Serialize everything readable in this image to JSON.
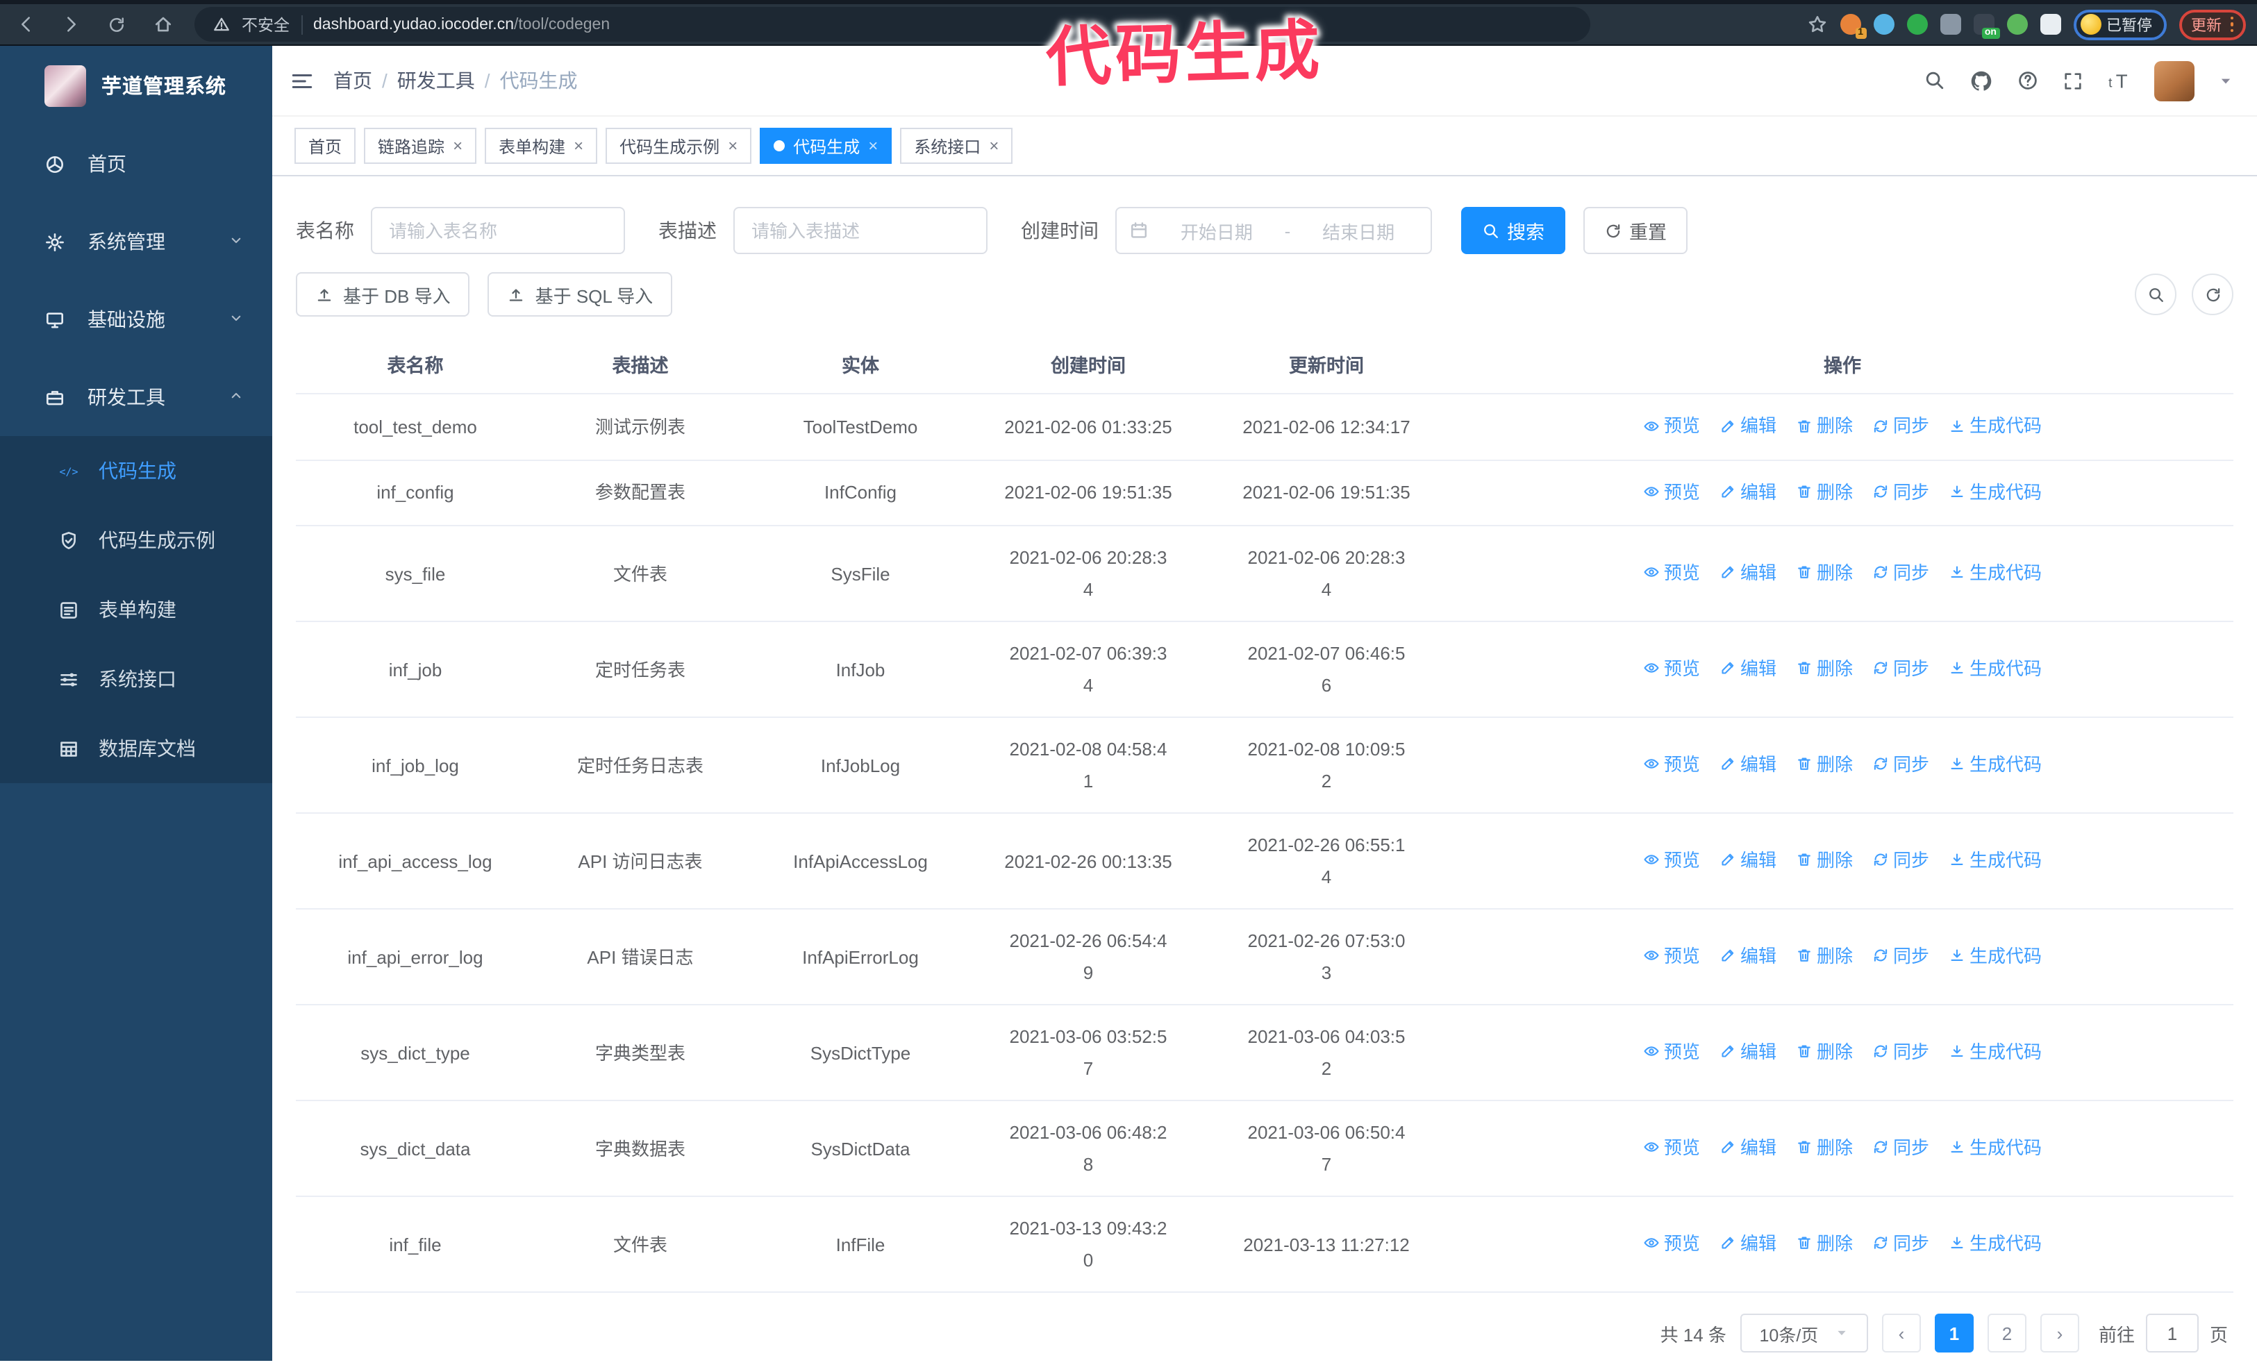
{
  "colors": {
    "accent": "#1890ff",
    "link": "#409eff",
    "sidebar_bg": "#204668",
    "submenu_bg": "#1a3a57",
    "annotation": "#fb3a5e"
  },
  "annotation": {
    "text": "代码生成"
  },
  "browser": {
    "insecure_label": "不安全",
    "url_domain": "dashboard.yudao.iocoder.cn",
    "url_path": "/tool/codegen",
    "paused_label": "已暂停",
    "update_label": "更新",
    "extensions": [
      {
        "name": "extension-orange-icon",
        "color": "#e8833a",
        "shape": "circle",
        "badge": "1"
      },
      {
        "name": "extension-gem-icon",
        "color": "#58b5e6",
        "shape": "circle",
        "badge": ""
      },
      {
        "name": "extension-green-check-icon",
        "color": "#2fae4d",
        "shape": "circle",
        "badge": ""
      },
      {
        "name": "extension-gray-icon",
        "color": "#8a97a5",
        "shape": "square",
        "badge": ""
      },
      {
        "name": "extension-dark-icon",
        "color": "#3a4450",
        "shape": "square",
        "badge": "on"
      },
      {
        "name": "extension-lime-icon",
        "color": "#5cb85c",
        "shape": "circle",
        "badge": ""
      },
      {
        "name": "extension-puzzle-icon",
        "color": "#e9eef2",
        "shape": "square",
        "badge": ""
      }
    ]
  },
  "sidebar": {
    "title": "芋道管理系统",
    "items": [
      {
        "id": "home",
        "label": "首页",
        "icon": "dashboard-icon",
        "chevron": ""
      },
      {
        "id": "system",
        "label": "系统管理",
        "icon": "gear-icon",
        "chevron": "down"
      },
      {
        "id": "infra",
        "label": "基础设施",
        "icon": "monitor-icon",
        "chevron": "down"
      },
      {
        "id": "devtools",
        "label": "研发工具",
        "icon": "toolbox-icon",
        "chevron": "up"
      }
    ],
    "subitems": [
      {
        "id": "codegen",
        "label": "代码生成",
        "icon": "code-icon",
        "active": true
      },
      {
        "id": "codegen-example",
        "label": "代码生成示例",
        "icon": "shield-icon",
        "active": false
      },
      {
        "id": "form-builder",
        "label": "表单构建",
        "icon": "form-icon",
        "active": false
      },
      {
        "id": "system-api",
        "label": "系统接口",
        "icon": "sliders-icon",
        "active": false
      },
      {
        "id": "db-doc",
        "label": "数据库文档",
        "icon": "database-icon",
        "active": false
      }
    ]
  },
  "header": {
    "breadcrumb": [
      "首页",
      "研发工具",
      "代码生成"
    ],
    "tabs": [
      {
        "label": "首页",
        "closable": false,
        "active": false
      },
      {
        "label": "链路追踪",
        "closable": true,
        "active": false
      },
      {
        "label": "表单构建",
        "closable": true,
        "active": false
      },
      {
        "label": "代码生成示例",
        "closable": true,
        "active": false
      },
      {
        "label": "代码生成",
        "closable": true,
        "active": true
      },
      {
        "label": "系统接口",
        "closable": true,
        "active": false
      }
    ]
  },
  "filters": {
    "table_name_label": "表名称",
    "table_name_placeholder": "请输入表名称",
    "table_desc_label": "表描述",
    "table_desc_placeholder": "请输入表描述",
    "create_time_label": "创建时间",
    "start_date_placeholder": "开始日期",
    "range_separator": "-",
    "end_date_placeholder": "结束日期",
    "search_label": "搜索",
    "reset_label": "重置"
  },
  "toolbar": {
    "import_db_label": "基于 DB 导入",
    "import_sql_label": "基于 SQL 导入"
  },
  "table": {
    "columns": [
      "表名称",
      "表描述",
      "实体",
      "创建时间",
      "更新时间",
      "操作"
    ],
    "actions": [
      {
        "label": "预览",
        "icon": "eye-icon"
      },
      {
        "label": "编辑",
        "icon": "edit-icon"
      },
      {
        "label": "删除",
        "icon": "delete-icon"
      },
      {
        "label": "同步",
        "icon": "sync-icon"
      },
      {
        "label": "生成代码",
        "icon": "download-icon"
      }
    ],
    "rows": [
      {
        "name": "tool_test_demo",
        "desc": "测试示例表",
        "entity": "ToolTestDemo",
        "create_time": "2021-02-06 01:33:25",
        "update_time": "2021-02-06 12:34:17"
      },
      {
        "name": "inf_config",
        "desc": "参数配置表",
        "entity": "InfConfig",
        "create_time": "2021-02-06 19:51:35",
        "update_time": "2021-02-06 19:51:35"
      },
      {
        "name": "sys_file",
        "desc": "文件表",
        "entity": "SysFile",
        "create_time": "2021-02-06 20:28:3\n4",
        "update_time": "2021-02-06 20:28:3\n4"
      },
      {
        "name": "inf_job",
        "desc": "定时任务表",
        "entity": "InfJob",
        "create_time": "2021-02-07 06:39:3\n4",
        "update_time": "2021-02-07 06:46:5\n6"
      },
      {
        "name": "inf_job_log",
        "desc": "定时任务日志表",
        "entity": "InfJobLog",
        "create_time": "2021-02-08 04:58:4\n1",
        "update_time": "2021-02-08 10:09:5\n2"
      },
      {
        "name": "inf_api_access_log",
        "desc": "API 访问日志表",
        "entity": "InfApiAccessLog",
        "create_time": "2021-02-26 00:13:35",
        "update_time": "2021-02-26 06:55:1\n4"
      },
      {
        "name": "inf_api_error_log",
        "desc": "API 错误日志",
        "entity": "InfApiErrorLog",
        "create_time": "2021-02-26 06:54:4\n9",
        "update_time": "2021-02-26 07:53:0\n3"
      },
      {
        "name": "sys_dict_type",
        "desc": "字典类型表",
        "entity": "SysDictType",
        "create_time": "2021-03-06 03:52:5\n7",
        "update_time": "2021-03-06 04:03:5\n2"
      },
      {
        "name": "sys_dict_data",
        "desc": "字典数据表",
        "entity": "SysDictData",
        "create_time": "2021-03-06 06:48:2\n8",
        "update_time": "2021-03-06 06:50:4\n7"
      },
      {
        "name": "inf_file",
        "desc": "文件表",
        "entity": "InfFile",
        "create_time": "2021-03-13 09:43:2\n0",
        "update_time": "2021-03-13 11:27:12"
      }
    ]
  },
  "pagination": {
    "total_label": "共 14 条",
    "page_size_label": "10条/页",
    "pages": [
      "1",
      "2"
    ],
    "active_page": "1",
    "goto_label": "前往",
    "goto_value": "1",
    "page_unit_label": "页"
  }
}
